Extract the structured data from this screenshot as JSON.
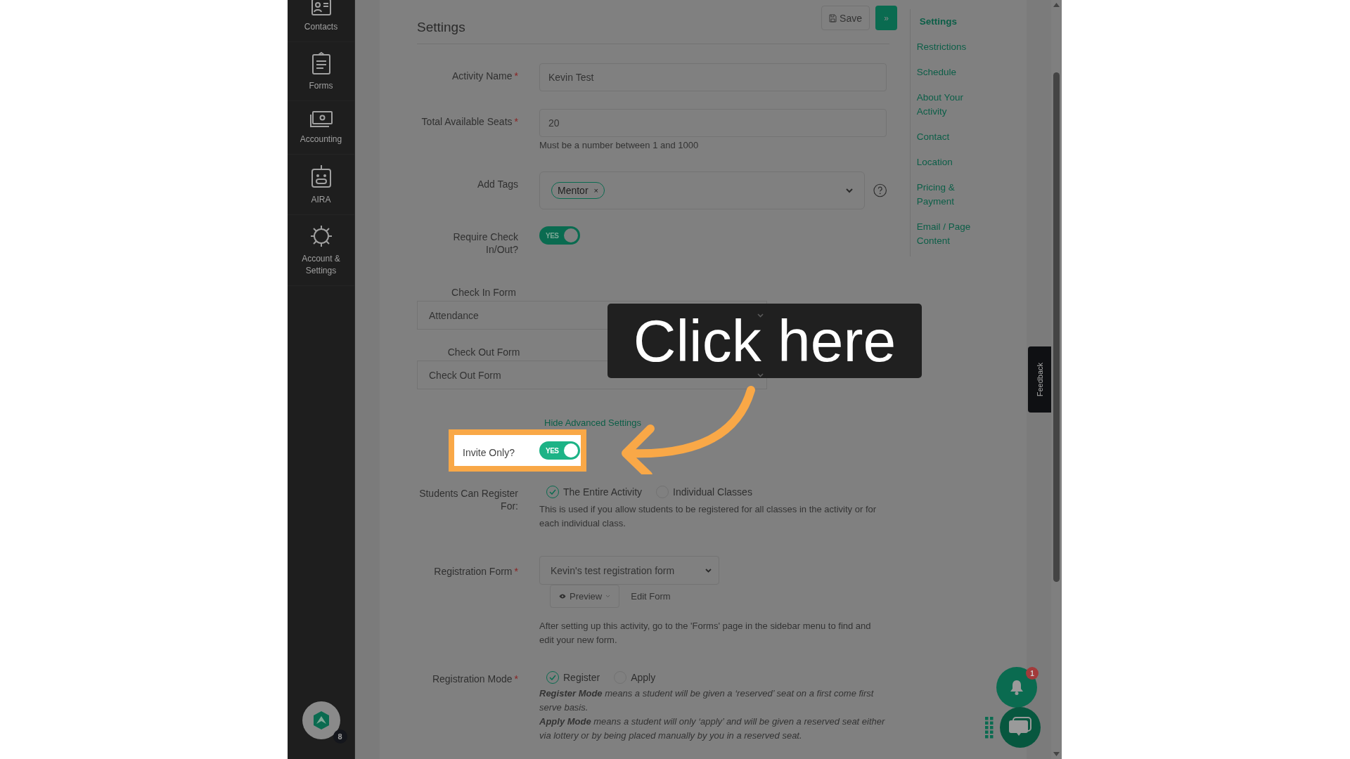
{
  "sidebar": {
    "items": [
      {
        "label": "Contacts"
      },
      {
        "label": "Forms"
      },
      {
        "label": "Accounting"
      },
      {
        "label": "AIRA"
      },
      {
        "label": "Account & Settings"
      }
    ],
    "avatar_badge": "8"
  },
  "toolbar": {
    "save": "Save",
    "next": "»"
  },
  "page_title": "Settings",
  "required_mark": "*",
  "rows": [
    {
      "kind": "text",
      "label": "Activity Name",
      "required": true,
      "value": "Kevin Test"
    },
    {
      "kind": "text",
      "label": "Total Available Seats",
      "required": true,
      "value": "20",
      "hint": "Must be a number between 1 and 1000"
    },
    {
      "kind": "tags",
      "label": "Add Tags",
      "required": false,
      "tags": [
        "Mentor"
      ],
      "remove": "×"
    },
    {
      "kind": "toggle",
      "label": "Require Check In/Out?",
      "required": false,
      "on": true,
      "text": "YES",
      "highlighted": false
    },
    {
      "kind": "stacked_select",
      "label": "Check In Form",
      "value": "Attendance"
    },
    {
      "kind": "stacked_select",
      "label": "Check Out Form",
      "value": "Check Out Form"
    },
    {
      "kind": "link",
      "text": "Hide Advanced Settings"
    },
    {
      "kind": "toggle",
      "label": "Invite Only?",
      "required": false,
      "on": true,
      "text": "YES",
      "highlighted": true
    },
    {
      "kind": "radio",
      "label": "Students Can Register For:",
      "required": false,
      "options": [
        {
          "label": "The Entire Activity",
          "selected": true
        },
        {
          "label": "Individual Classes",
          "selected": false
        }
      ],
      "notes": [
        "This is used if you allow students to be registered for all classes in the activity or for each individual class."
      ]
    },
    {
      "kind": "form_select",
      "label": "Registration Form",
      "required": true,
      "value": "Kevin's test registration form",
      "preview": "Preview",
      "edit": "Edit Form",
      "notes": [
        "After setting up this activity, go to the 'Forms' page in the sidebar menu to find and edit your new form."
      ]
    },
    {
      "kind": "radio",
      "label": "Registration Mode",
      "required": true,
      "options": [
        {
          "label": "Register",
          "selected": true
        },
        {
          "label": "Apply",
          "selected": false
        }
      ],
      "italic_notes": [
        "**Register Mode** means a student will be given a ‘reserved’ seat on a first come first serve basis.",
        "**Apply Mode** means a student will only ‘apply’ and will be given a reserved seat either via lottery or by being placed manually by you in a reserved seat."
      ]
    }
  ],
  "section_nav": [
    {
      "label": "Settings",
      "selected": true
    },
    {
      "label": "Restrictions",
      "selected": false
    },
    {
      "label": "Schedule",
      "selected": false
    },
    {
      "label": "About Your Activity",
      "selected": false
    },
    {
      "label": "Contact",
      "selected": false
    },
    {
      "label": "Location",
      "selected": false
    },
    {
      "label": "Pricing & Payment",
      "selected": false
    },
    {
      "label": "Email / Page Content",
      "selected": false
    }
  ],
  "feedback_tab": "Feedback",
  "notification_badge": "1",
  "callout": {
    "text": "Click here"
  }
}
